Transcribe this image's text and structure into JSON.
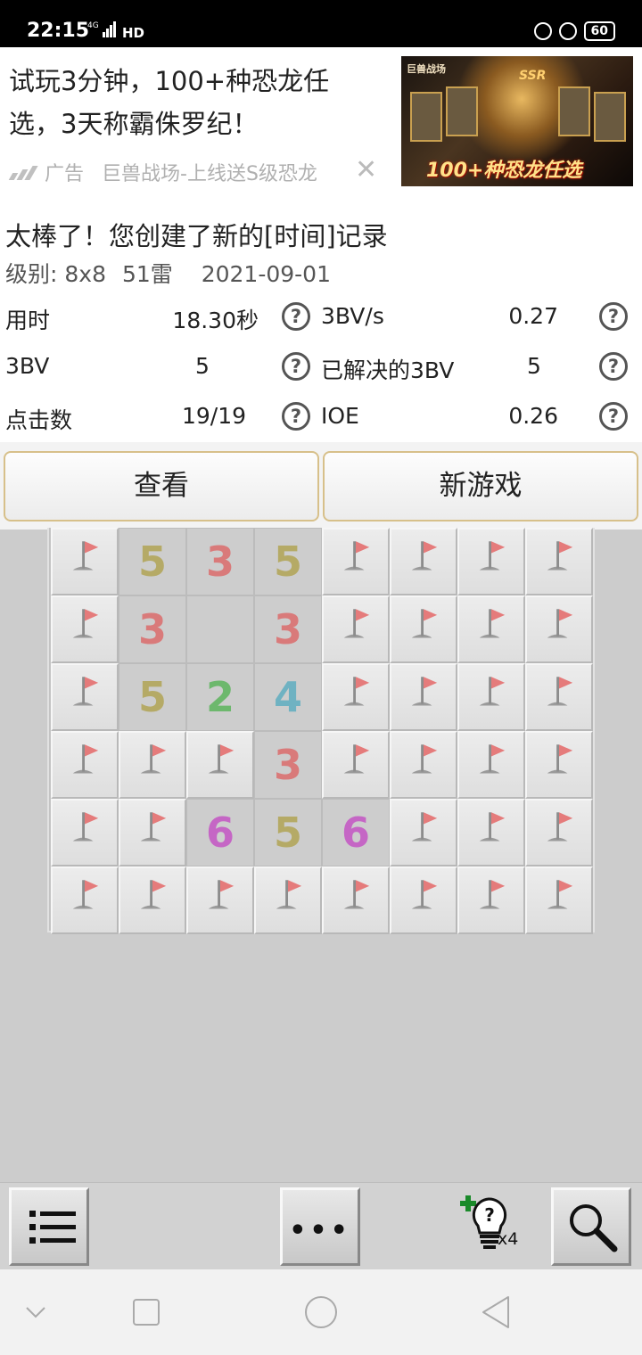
{
  "status_bar": {
    "time": "22:15",
    "network": "4G",
    "hd": "HD",
    "battery": "60"
  },
  "ad": {
    "headline": "试玩3分钟，100+种恐龙任选，3天称霸侏罗纪！",
    "label": "广告",
    "source": "巨兽战场-上线送S级恐龙",
    "close_glyph": "✕",
    "image_brand": "巨兽战场",
    "image_badge": "SSR",
    "image_caption": "100+种恐龙任选"
  },
  "result": {
    "title": "太棒了！您创建了新的[时间]记录",
    "level": "级别: 8x8",
    "mines": "51雷",
    "date": "2021-09-01",
    "stats": [
      {
        "label": "用时",
        "value": "18.30秒",
        "label2": "3BV/s",
        "value2": "0.27"
      },
      {
        "label": "3BV",
        "value": "5",
        "label2": "已解决的3BV",
        "value2": "5"
      },
      {
        "label": "点击数",
        "value": "19/19",
        "label2": "IOE",
        "value2": "0.26"
      }
    ],
    "help_glyph": "?"
  },
  "buttons": {
    "view": "查看",
    "new_game": "新游戏"
  },
  "board": {
    "columns": 8,
    "rows": [
      [
        "F",
        "5",
        "3",
        "5",
        "F",
        "F",
        "F",
        "F"
      ],
      [
        "F",
        "3",
        "",
        "3",
        "F",
        "F",
        "F",
        "F"
      ],
      [
        "F",
        "5",
        "2",
        "4",
        "F",
        "F",
        "F",
        "F"
      ],
      [
        "F",
        "F",
        "F",
        "3",
        "F",
        "F",
        "F",
        "F"
      ],
      [
        "F",
        "F",
        "6",
        "5",
        "6",
        "F",
        "F",
        "F"
      ],
      [
        "F",
        "F",
        "F",
        "F",
        "F",
        "F",
        "F",
        "F"
      ]
    ],
    "number_colors": {
      "2": "#6db86d",
      "3": "#d97a7a",
      "4": "#6fb2c2",
      "5": "#b5aa66",
      "6": "#c566c5"
    },
    "flag_color": "#e57b7b"
  },
  "toolbar": {
    "menu_icon": "list-icon",
    "more_glyph": "•••",
    "hint_glyph": "?",
    "hint_count": "x4",
    "search_icon": "magnifier-icon"
  },
  "navbar": {
    "icons": [
      "chevron-down-icon",
      "square-icon",
      "circle-icon",
      "back-triangle-icon"
    ]
  }
}
